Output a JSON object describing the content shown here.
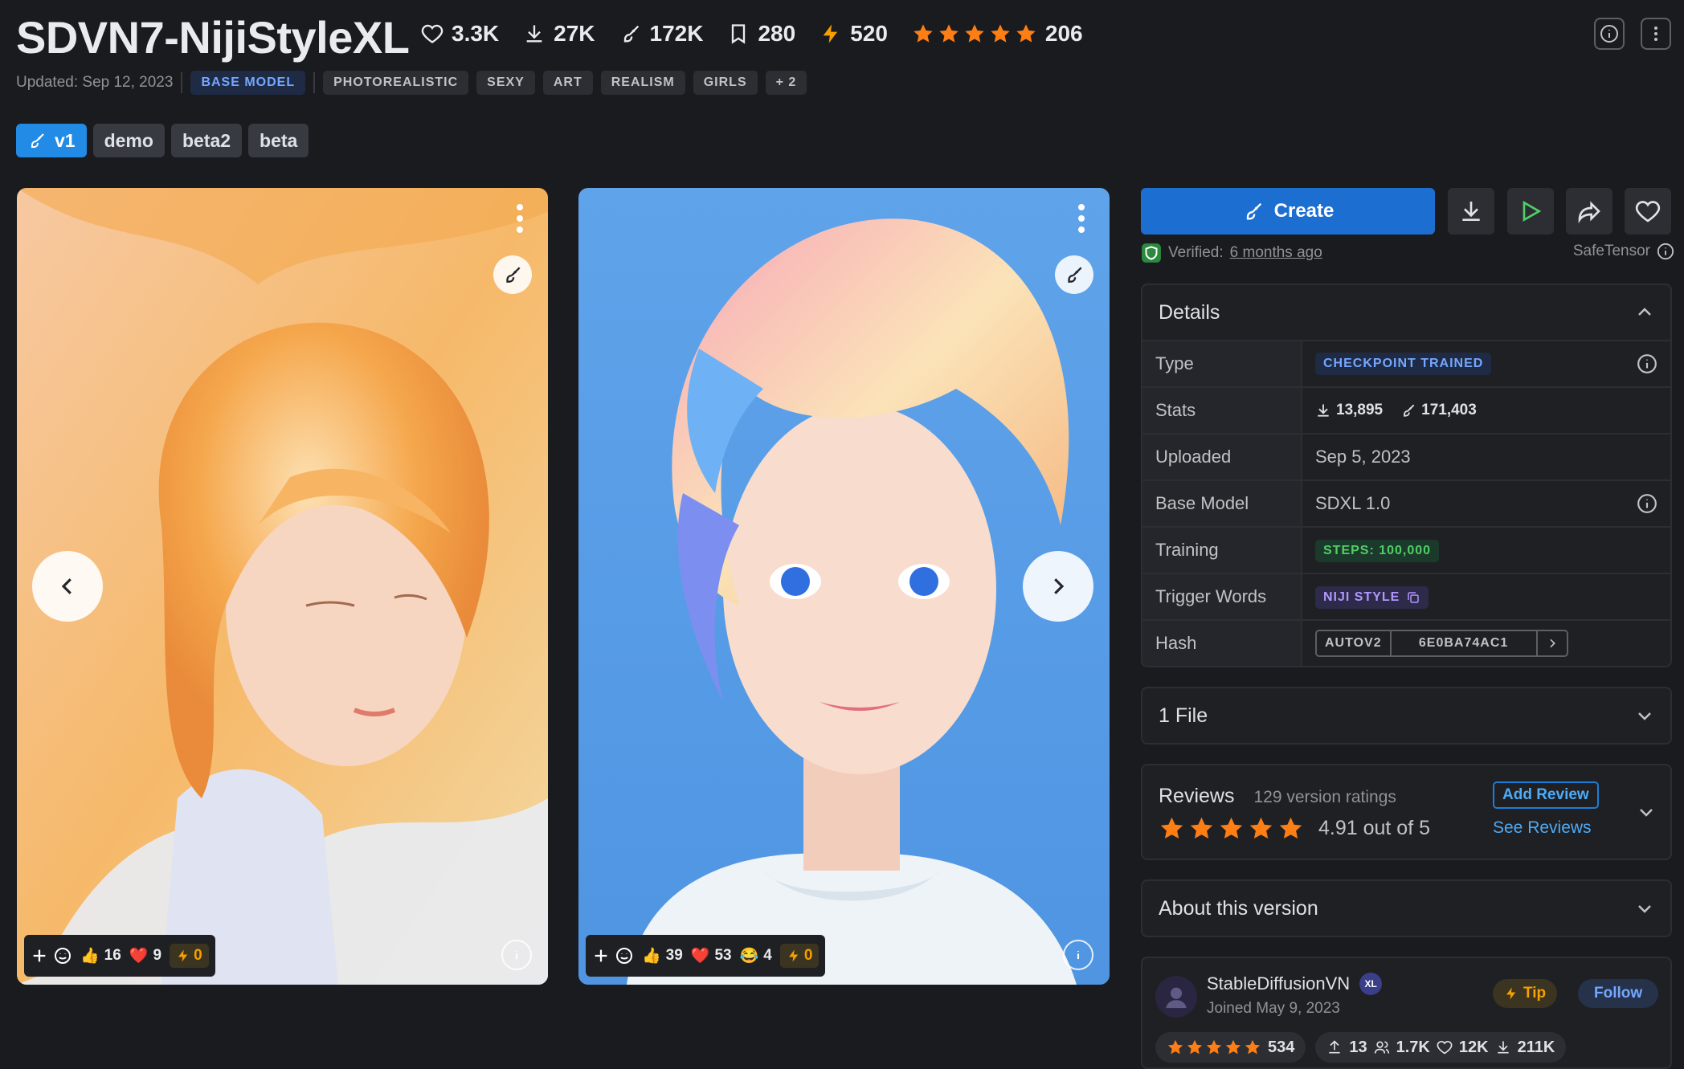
{
  "header": {
    "title": "SDVN7-NijiStyleXL",
    "stats": {
      "likes": "3.3K",
      "downloads": "27K",
      "generations": "172K",
      "bookmarks": "280",
      "buzz": "520",
      "rating_count": "206"
    },
    "updated": "Updated: Sep 12, 2023",
    "tags": [
      "BASE MODEL",
      "PHOTOREALISTIC",
      "SEXY",
      "ART",
      "REALISM",
      "GIRLS",
      "+ 2"
    ]
  },
  "versions": [
    "v1",
    "demo",
    "beta2",
    "beta"
  ],
  "cards": [
    {
      "reactions": {
        "likes": "16",
        "hearts": "9",
        "buzz": "0"
      }
    },
    {
      "reactions": {
        "likes": "39",
        "hearts": "53",
        "laugh": "4",
        "buzz": "0"
      }
    }
  ],
  "actions": {
    "create_label": "Create"
  },
  "verified": {
    "label": "Verified:",
    "time": "6 months ago",
    "format": "SafeTensor"
  },
  "details": {
    "title": "Details",
    "rows": {
      "type": {
        "label": "Type",
        "value": "CHECKPOINT TRAINED"
      },
      "stats": {
        "label": "Stats",
        "downloads": "13,895",
        "generations": "171,403"
      },
      "uploaded": {
        "label": "Uploaded",
        "value": "Sep 5, 2023"
      },
      "base_model": {
        "label": "Base Model",
        "value": "SDXL 1.0"
      },
      "training": {
        "label": "Training",
        "value": "STEPS: 100,000"
      },
      "trigger_words": {
        "label": "Trigger Words",
        "value": "NIJI STYLE"
      },
      "hash": {
        "label": "Hash",
        "type": "AUTOV2",
        "value": "6E0BA74AC1"
      }
    }
  },
  "files": {
    "title": "1 File"
  },
  "reviews": {
    "title": "Reviews",
    "count_text": "129 version ratings",
    "score_text": "4.91 out of 5",
    "add_label": "Add Review",
    "see_label": "See Reviews"
  },
  "about": {
    "title": "About this version"
  },
  "creator": {
    "name": "StableDiffusionVN",
    "joined": "Joined May 9, 2023",
    "tip_label": "Tip",
    "follow_label": "Follow",
    "rating_count": "534",
    "uploads": "13",
    "followers": "1.7K",
    "likes": "12K",
    "downloads": "211K"
  },
  "colors": {
    "accent": "#228be6",
    "star": "#fd7e14",
    "buzz": "#f59f00",
    "background": "#1a1b1e"
  }
}
